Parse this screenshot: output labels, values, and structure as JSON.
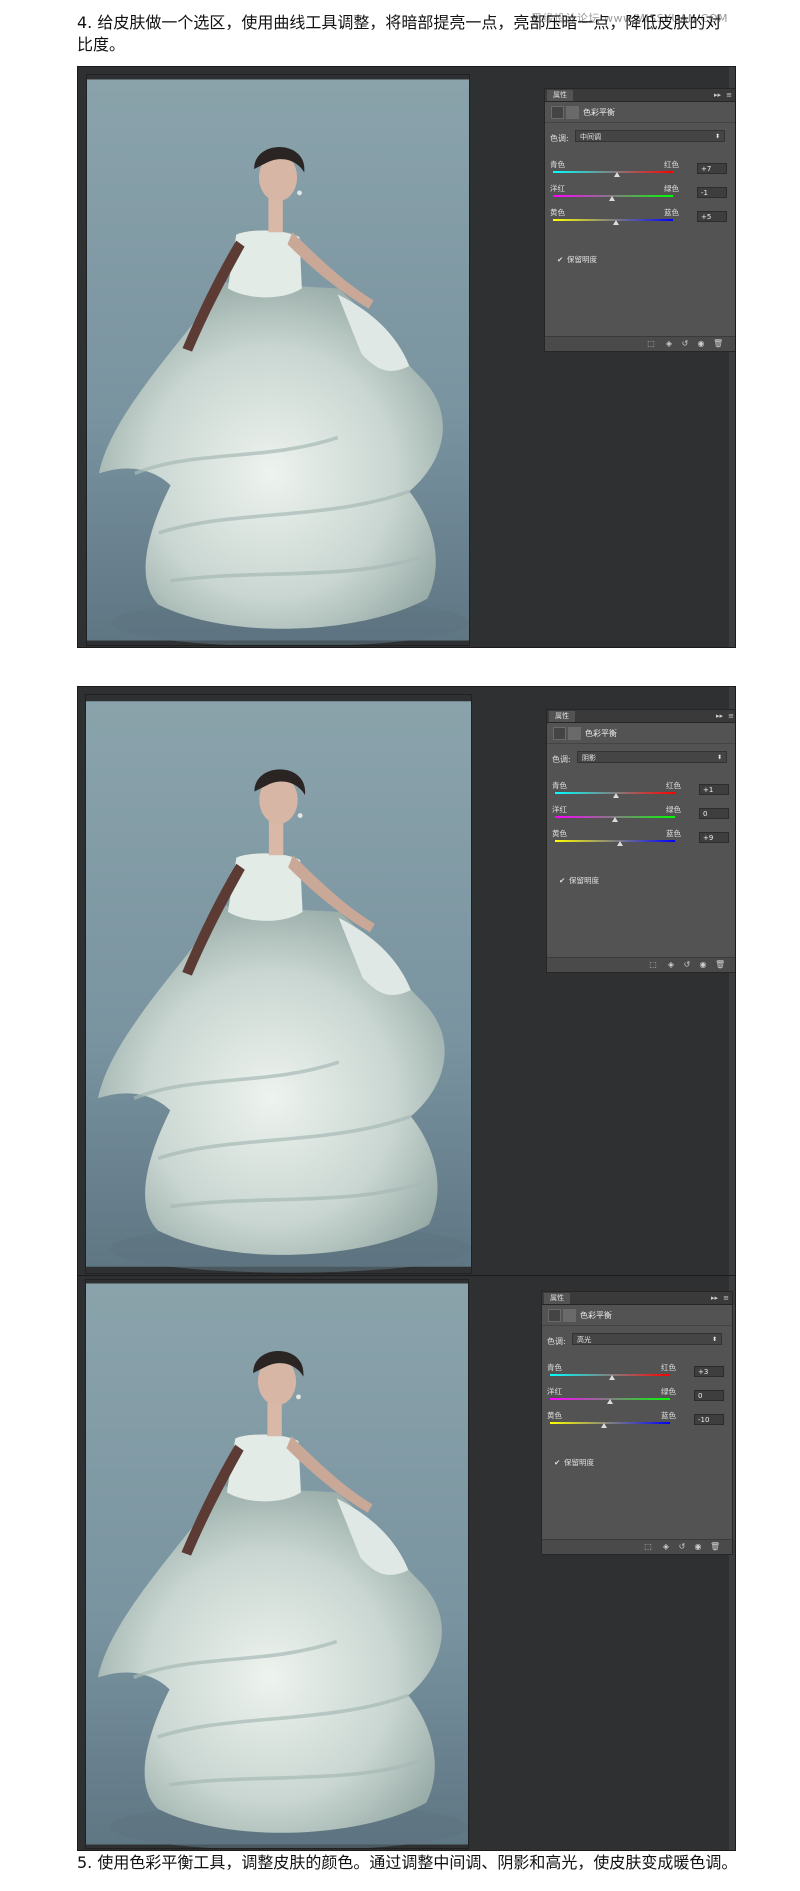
{
  "watermark": "思缘设计论坛 www.MISSYUAN.COM",
  "intro_text": "4. 给皮肤做一个选区，使用曲线工具调整，将暗部提亮一点，亮部压暗一点，降低皮肤的对比度。",
  "outro_text": "5. 使用色彩平衡工具，调整皮肤的颜色。通过调整中间调、阴影和高光，使皮肤变成暖色调。",
  "panel_common": {
    "tab_label": "属性",
    "title": "色彩平衡",
    "tone_label": "色调:",
    "collapse_glyph": "▸▸",
    "menu_glyph": "≡",
    "sliders": [
      {
        "left": "青色",
        "right": "红色",
        "colors": [
          "#00ffff",
          "#ff0000"
        ]
      },
      {
        "left": "洋红",
        "right": "绿色",
        "colors": [
          "#ff00ff",
          "#00ff00"
        ]
      },
      {
        "left": "黄色",
        "right": "蓝色",
        "colors": [
          "#ffff00",
          "#0000ff"
        ]
      }
    ],
    "preserve_label": "保留明度",
    "preserve_checked": true,
    "footer_icons": [
      "clip-icon",
      "visibility-cycle-icon",
      "reset-icon",
      "eye-icon",
      "trash-icon"
    ]
  },
  "panels": [
    {
      "tone": "中间调",
      "values": [
        "+7",
        "-1",
        "+5"
      ],
      "fractions": [
        0.535,
        0.495,
        0.525
      ]
    },
    {
      "tone": "阴影",
      "values": [
        "+1",
        "0",
        "+9"
      ],
      "fractions": [
        0.505,
        0.5,
        0.545
      ]
    },
    {
      "tone": "高光",
      "values": [
        "+3",
        "0",
        "-10"
      ],
      "fractions": [
        0.515,
        0.5,
        0.45
      ]
    }
  ],
  "colors": {
    "ps_background": "#2e3031",
    "panel_bg": "#535353",
    "photo_backdrop": "#7e9aa2"
  }
}
